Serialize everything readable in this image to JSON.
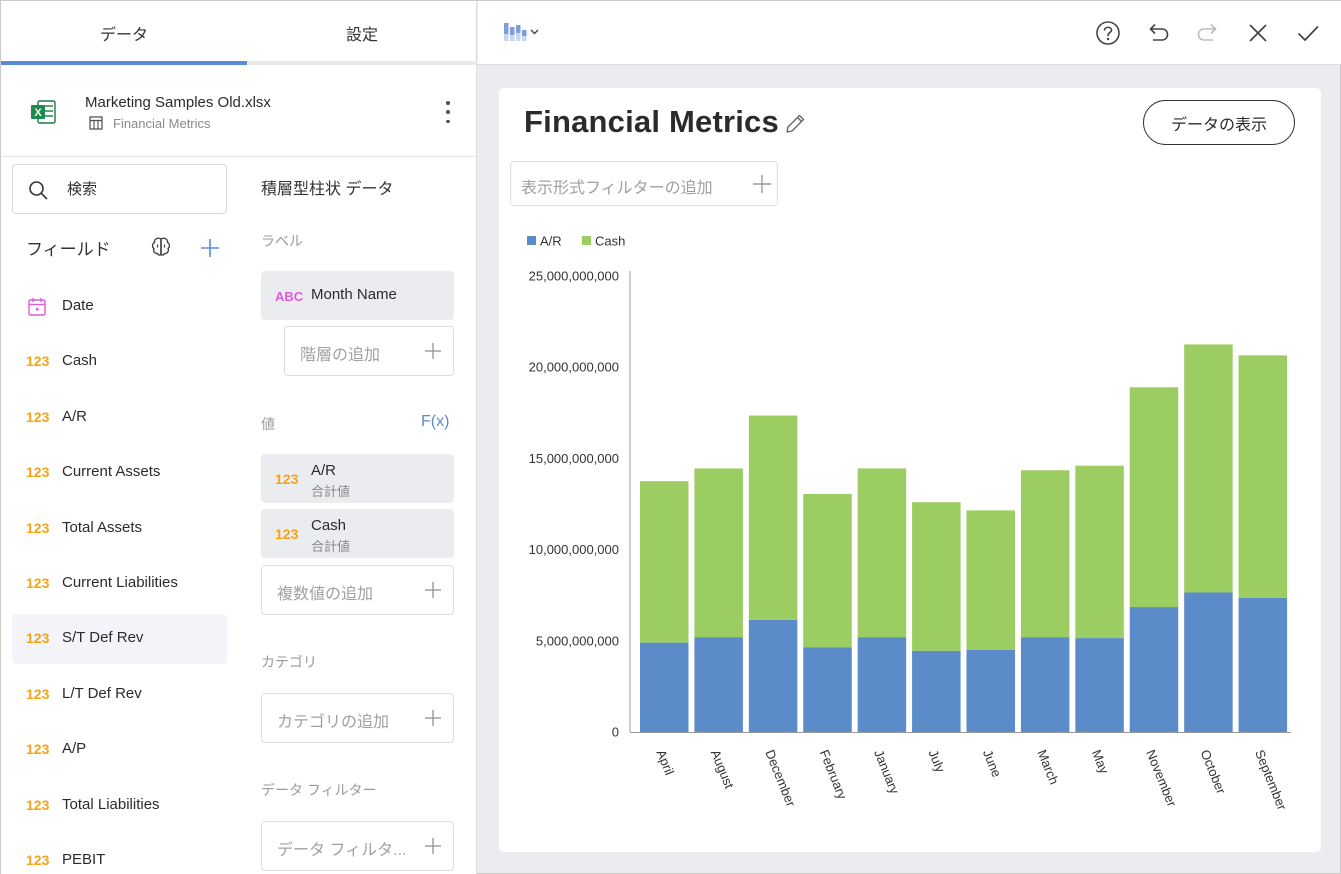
{
  "tabs": {
    "data": "データ",
    "settings": "設定"
  },
  "datasource": {
    "file": "Marketing Samples Old.xlsx",
    "sheet": "Financial Metrics"
  },
  "search": {
    "placeholder": "検索"
  },
  "fields": {
    "title": "フィールド",
    "items": [
      {
        "icon": "calendar-icon",
        "label": "Date"
      },
      {
        "icon": "123",
        "label": "Cash"
      },
      {
        "icon": "123",
        "label": "A/R"
      },
      {
        "icon": "123",
        "label": "Current Assets"
      },
      {
        "icon": "123",
        "label": "Total Assets"
      },
      {
        "icon": "123",
        "label": "Current Liabilities"
      },
      {
        "icon": "123",
        "label": "S/T Def Rev"
      },
      {
        "icon": "123",
        "label": "L/T Def Rev"
      },
      {
        "icon": "123",
        "label": "A/P"
      },
      {
        "icon": "123",
        "label": "Total Liabilities"
      },
      {
        "icon": "123",
        "label": "PEBIT"
      }
    ],
    "selected": "S/T Def Rev"
  },
  "config": {
    "viz_title": "積層型柱状 データ",
    "label_section": "ラベル",
    "label_pill": {
      "icon": "ABC",
      "text": "Month Name"
    },
    "add_hierarchy": "階層の追加",
    "values_section": "値",
    "fx": "F(x)",
    "value_pills": [
      {
        "icon": "123",
        "text": "A/R",
        "sub": "合計値"
      },
      {
        "icon": "123",
        "text": "Cash",
        "sub": "合計値"
      }
    ],
    "add_values": "複数値の追加",
    "category_section": "カテゴリ",
    "add_category": "カテゴリの追加",
    "filter_section": "データ フィルター",
    "add_filter": "データ フィルタ..."
  },
  "card": {
    "title": "Financial Metrics",
    "view_data": "データの表示",
    "visual_filter": "表示形式フィルターの追加"
  },
  "colors": {
    "ar": "#5b8bc9",
    "cash": "#9ccd62",
    "accent": "#5b8bd8",
    "int_icon": "#f5a315",
    "text_icon": "#e25bd8"
  },
  "chart_data": {
    "type": "bar",
    "stacked": true,
    "categories": [
      "April",
      "August",
      "December",
      "February",
      "January",
      "July",
      "June",
      "March",
      "May",
      "November",
      "October",
      "September"
    ],
    "series": [
      {
        "name": "A/R",
        "color": "#5b8bc9",
        "values": [
          4900000000,
          5200000000,
          6150000000,
          4650000000,
          5200000000,
          4450000000,
          4500000000,
          5200000000,
          5150000000,
          6850000000,
          7650000000,
          7350000000
        ]
      },
      {
        "name": "Cash",
        "color": "#9ccd62",
        "values": [
          8850000000,
          9250000000,
          11200000000,
          8400000000,
          9250000000,
          8150000000,
          7650000000,
          9150000000,
          9450000000,
          12050000000,
          13600000000,
          13300000000
        ]
      }
    ],
    "yticks": [
      "0",
      "5,000,000,000",
      "10,000,000,000",
      "15,000,000,000",
      "20,000,000,000",
      "25,000,000,000"
    ],
    "ylim": [
      0,
      25000000000
    ],
    "legend": "top-left",
    "grid": false
  }
}
